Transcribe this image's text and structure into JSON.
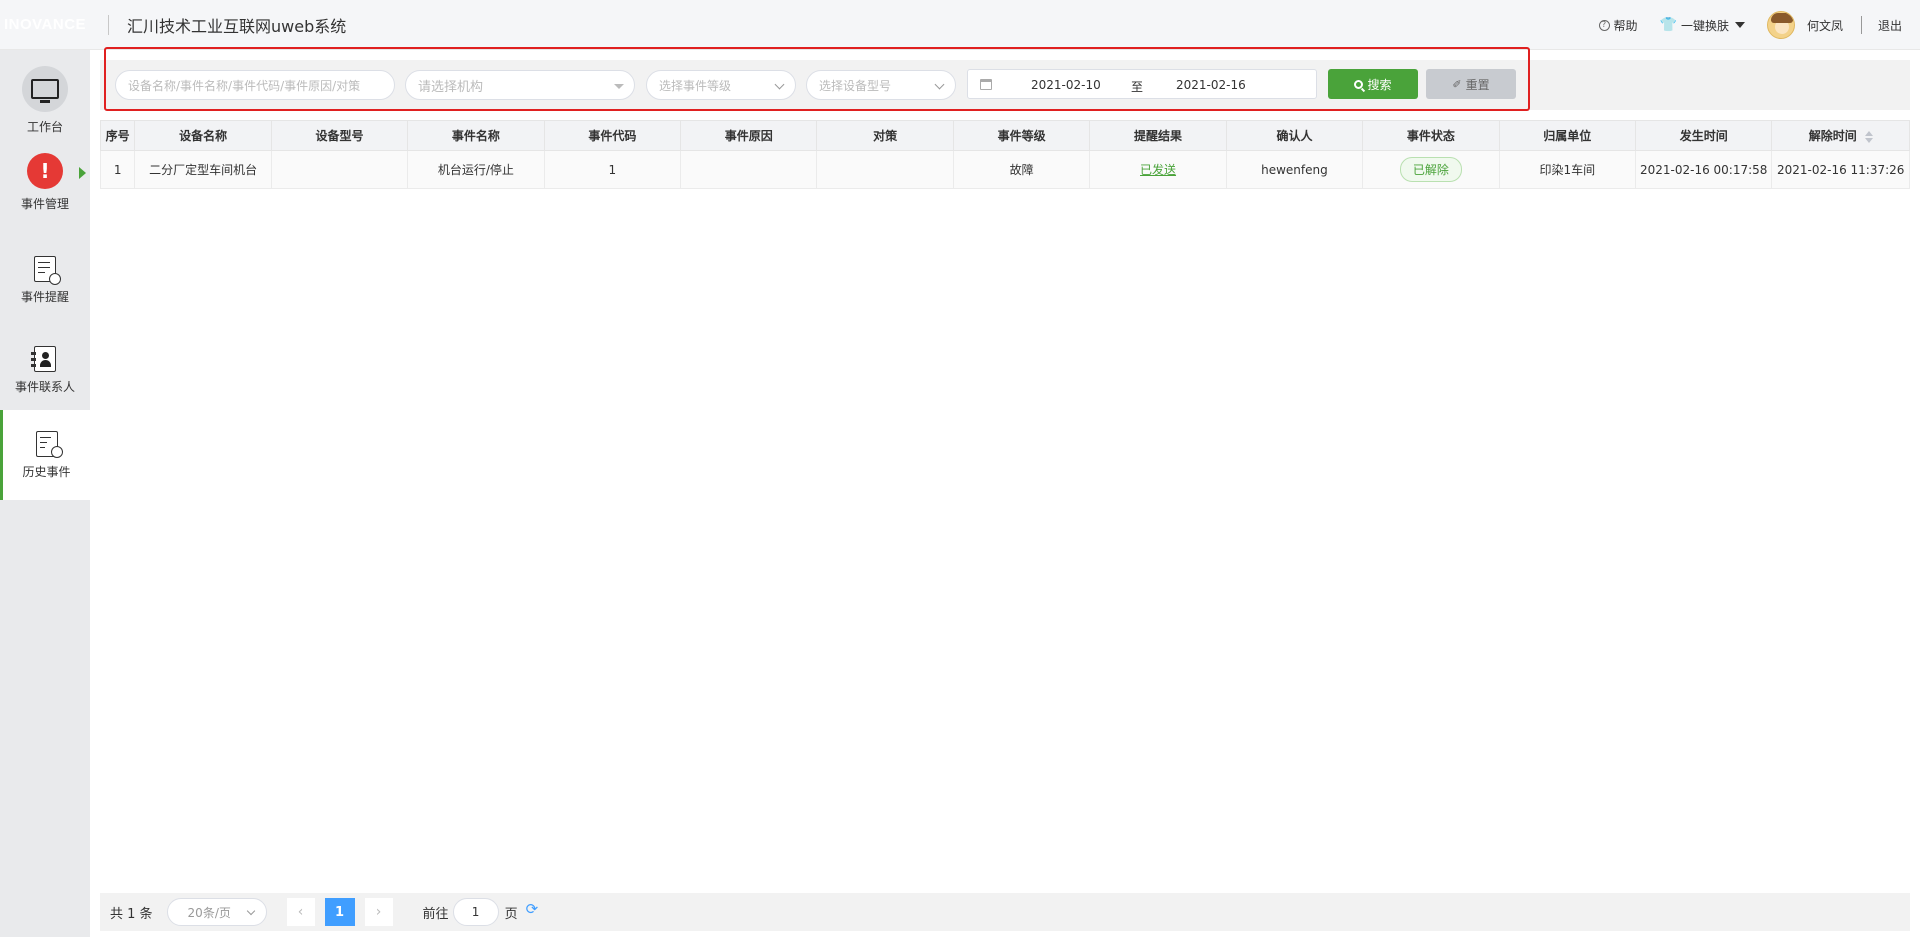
{
  "header": {
    "logo": "INOVANCE",
    "title": "汇川技术工业互联网uweb系统",
    "help": "帮助",
    "skin": "一键换肤",
    "user": "何文凤",
    "logout": "退出"
  },
  "sidebar": {
    "items": [
      {
        "label": "工作台",
        "icon": "monitor-icon"
      },
      {
        "label": "事件管理",
        "icon": "warning-icon"
      },
      {
        "label": "事件提醒",
        "icon": "reminder-doc-icon"
      },
      {
        "label": "事件联系人",
        "icon": "contact-book-icon"
      },
      {
        "label": "历史事件",
        "icon": "history-search-icon"
      }
    ],
    "active_index": 4
  },
  "filters": {
    "keyword_placeholder": "设备名称/事件名称/事件代码/事件原因/对策",
    "org_placeholder": "请选择机构",
    "level_placeholder": "选择事件等级",
    "model_placeholder": "选择设备型号",
    "date_start": "2021-02-10",
    "date_sep": "至",
    "date_end": "2021-02-16",
    "search_label": "搜索",
    "reset_label": "重置"
  },
  "table": {
    "columns": [
      "序号",
      "设备名称",
      "设备型号",
      "事件名称",
      "事件代码",
      "事件原因",
      "对策",
      "事件等级",
      "提醒结果",
      "确认人",
      "事件状态",
      "归属单位",
      "发生时间",
      "解除时间"
    ],
    "rows": [
      {
        "index": "1",
        "device_name": "二分厂定型车间机台",
        "device_model": "",
        "event_name": "机台运行/停止",
        "event_code": "1",
        "event_reason": "",
        "measure": "",
        "level": "故障",
        "remind_result": "已发送",
        "confirmer": "hewenfeng",
        "status": "已解除",
        "unit": "印染1车间",
        "occur_time": "2021-02-16 00:17:58",
        "release_time": "2021-02-16 11:37:26"
      }
    ]
  },
  "pagination": {
    "total": "共 1 条",
    "page_size": "20条/页",
    "prev": "‹",
    "current": "1",
    "next": "›",
    "goto_label": "前往",
    "goto_value": "1",
    "page_label": "页"
  },
  "colors": {
    "accent_green": "#4aa33a",
    "page_blue": "#409eff",
    "highlight_red": "#e02020",
    "warning_red": "#e53935"
  }
}
